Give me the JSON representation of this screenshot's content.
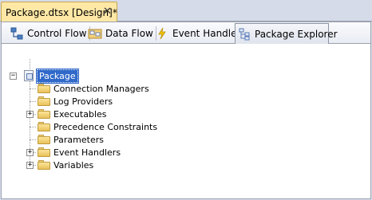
{
  "document_tab": {
    "title": "Package.dtsx [Design]*",
    "close_glyph": "✕"
  },
  "designer_tabs": [
    {
      "label": "Control Flow",
      "icon": "control-flow-icon",
      "active": false
    },
    {
      "label": "Data Flow",
      "icon": "data-flow-icon",
      "active": false
    },
    {
      "label": "Event Handlers",
      "icon": "lightning-icon",
      "active": false
    },
    {
      "label": "Package Explorer",
      "icon": "package-explorer-icon",
      "active": true
    }
  ],
  "tree": {
    "root": {
      "label": "Package",
      "expander": "−",
      "selected": true
    },
    "children": [
      {
        "label": "Connection Managers",
        "expandable": false
      },
      {
        "label": "Log Providers",
        "expandable": false
      },
      {
        "label": "Executables",
        "expandable": true,
        "expander": "+"
      },
      {
        "label": "Precedence Constraints",
        "expandable": false
      },
      {
        "label": "Parameters",
        "expandable": false
      },
      {
        "label": "Event Handlers",
        "expandable": true,
        "expander": "+"
      },
      {
        "label": "Variables",
        "expandable": true,
        "expander": "+"
      }
    ]
  },
  "colors": {
    "doc_tab_bg": "#ffe8a6",
    "selection_bg": "#3069c9",
    "folder_yellow": "#f4d67a"
  }
}
